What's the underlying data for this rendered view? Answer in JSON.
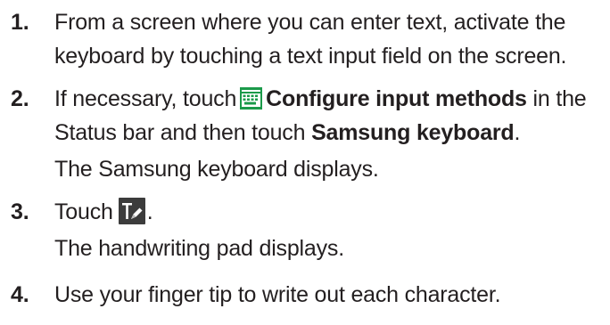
{
  "steps": [
    {
      "number": "1.",
      "line1": "From a screen where you can enter text, activate the",
      "line2": "keyboard by touching a text input field on the screen."
    },
    {
      "number": "2.",
      "pre": "If necessary, touch",
      "icon": "keyboard-icon",
      "bold1": "Configure input methods",
      "mid": "in the",
      "line2_pre": "Status bar and then touch",
      "bold2": "Samsung keyboard",
      "line2_post": ".",
      "result": "The Samsung keyboard displays."
    },
    {
      "number": "3.",
      "pre": "Touch",
      "icon": "handwriting-icon",
      "post": ".",
      "result": "The handwriting pad displays."
    },
    {
      "number": "4.",
      "line1": "Use your finger tip to write out each character."
    }
  ],
  "colors": {
    "text": "#231f20",
    "icon_green": "#1b9a4a",
    "icon_dark": "#3c3c3c"
  }
}
